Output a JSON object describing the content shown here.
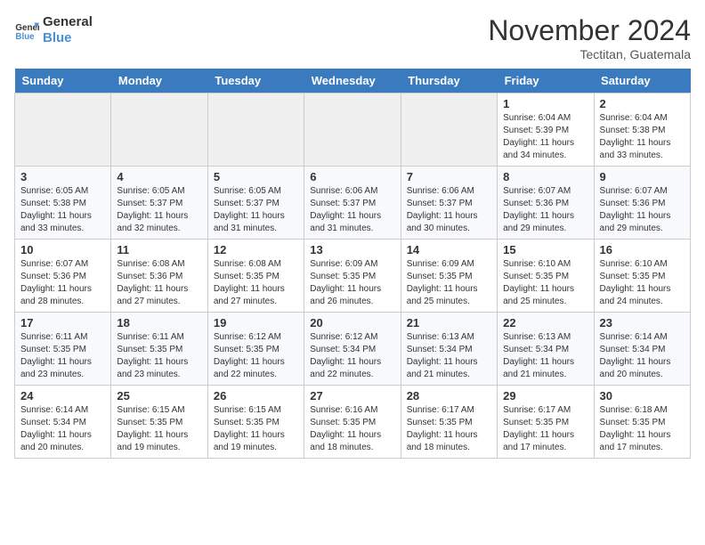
{
  "header": {
    "logo_line1": "General",
    "logo_line2": "Blue",
    "month": "November 2024",
    "location": "Tectitan, Guatemala"
  },
  "weekdays": [
    "Sunday",
    "Monday",
    "Tuesday",
    "Wednesday",
    "Thursday",
    "Friday",
    "Saturday"
  ],
  "weeks": [
    [
      {
        "day": "",
        "empty": true
      },
      {
        "day": "",
        "empty": true
      },
      {
        "day": "",
        "empty": true
      },
      {
        "day": "",
        "empty": true
      },
      {
        "day": "",
        "empty": true
      },
      {
        "day": "1",
        "sunrise": "Sunrise: 6:04 AM",
        "sunset": "Sunset: 5:39 PM",
        "daylight": "Daylight: 11 hours and 34 minutes."
      },
      {
        "day": "2",
        "sunrise": "Sunrise: 6:04 AM",
        "sunset": "Sunset: 5:38 PM",
        "daylight": "Daylight: 11 hours and 33 minutes."
      }
    ],
    [
      {
        "day": "3",
        "sunrise": "Sunrise: 6:05 AM",
        "sunset": "Sunset: 5:38 PM",
        "daylight": "Daylight: 11 hours and 33 minutes."
      },
      {
        "day": "4",
        "sunrise": "Sunrise: 6:05 AM",
        "sunset": "Sunset: 5:37 PM",
        "daylight": "Daylight: 11 hours and 32 minutes."
      },
      {
        "day": "5",
        "sunrise": "Sunrise: 6:05 AM",
        "sunset": "Sunset: 5:37 PM",
        "daylight": "Daylight: 11 hours and 31 minutes."
      },
      {
        "day": "6",
        "sunrise": "Sunrise: 6:06 AM",
        "sunset": "Sunset: 5:37 PM",
        "daylight": "Daylight: 11 hours and 31 minutes."
      },
      {
        "day": "7",
        "sunrise": "Sunrise: 6:06 AM",
        "sunset": "Sunset: 5:37 PM",
        "daylight": "Daylight: 11 hours and 30 minutes."
      },
      {
        "day": "8",
        "sunrise": "Sunrise: 6:07 AM",
        "sunset": "Sunset: 5:36 PM",
        "daylight": "Daylight: 11 hours and 29 minutes."
      },
      {
        "day": "9",
        "sunrise": "Sunrise: 6:07 AM",
        "sunset": "Sunset: 5:36 PM",
        "daylight": "Daylight: 11 hours and 29 minutes."
      }
    ],
    [
      {
        "day": "10",
        "sunrise": "Sunrise: 6:07 AM",
        "sunset": "Sunset: 5:36 PM",
        "daylight": "Daylight: 11 hours and 28 minutes."
      },
      {
        "day": "11",
        "sunrise": "Sunrise: 6:08 AM",
        "sunset": "Sunset: 5:36 PM",
        "daylight": "Daylight: 11 hours and 27 minutes."
      },
      {
        "day": "12",
        "sunrise": "Sunrise: 6:08 AM",
        "sunset": "Sunset: 5:35 PM",
        "daylight": "Daylight: 11 hours and 27 minutes."
      },
      {
        "day": "13",
        "sunrise": "Sunrise: 6:09 AM",
        "sunset": "Sunset: 5:35 PM",
        "daylight": "Daylight: 11 hours and 26 minutes."
      },
      {
        "day": "14",
        "sunrise": "Sunrise: 6:09 AM",
        "sunset": "Sunset: 5:35 PM",
        "daylight": "Daylight: 11 hours and 25 minutes."
      },
      {
        "day": "15",
        "sunrise": "Sunrise: 6:10 AM",
        "sunset": "Sunset: 5:35 PM",
        "daylight": "Daylight: 11 hours and 25 minutes."
      },
      {
        "day": "16",
        "sunrise": "Sunrise: 6:10 AM",
        "sunset": "Sunset: 5:35 PM",
        "daylight": "Daylight: 11 hours and 24 minutes."
      }
    ],
    [
      {
        "day": "17",
        "sunrise": "Sunrise: 6:11 AM",
        "sunset": "Sunset: 5:35 PM",
        "daylight": "Daylight: 11 hours and 23 minutes."
      },
      {
        "day": "18",
        "sunrise": "Sunrise: 6:11 AM",
        "sunset": "Sunset: 5:35 PM",
        "daylight": "Daylight: 11 hours and 23 minutes."
      },
      {
        "day": "19",
        "sunrise": "Sunrise: 6:12 AM",
        "sunset": "Sunset: 5:35 PM",
        "daylight": "Daylight: 11 hours and 22 minutes."
      },
      {
        "day": "20",
        "sunrise": "Sunrise: 6:12 AM",
        "sunset": "Sunset: 5:34 PM",
        "daylight": "Daylight: 11 hours and 22 minutes."
      },
      {
        "day": "21",
        "sunrise": "Sunrise: 6:13 AM",
        "sunset": "Sunset: 5:34 PM",
        "daylight": "Daylight: 11 hours and 21 minutes."
      },
      {
        "day": "22",
        "sunrise": "Sunrise: 6:13 AM",
        "sunset": "Sunset: 5:34 PM",
        "daylight": "Daylight: 11 hours and 21 minutes."
      },
      {
        "day": "23",
        "sunrise": "Sunrise: 6:14 AM",
        "sunset": "Sunset: 5:34 PM",
        "daylight": "Daylight: 11 hours and 20 minutes."
      }
    ],
    [
      {
        "day": "24",
        "sunrise": "Sunrise: 6:14 AM",
        "sunset": "Sunset: 5:34 PM",
        "daylight": "Daylight: 11 hours and 20 minutes."
      },
      {
        "day": "25",
        "sunrise": "Sunrise: 6:15 AM",
        "sunset": "Sunset: 5:35 PM",
        "daylight": "Daylight: 11 hours and 19 minutes."
      },
      {
        "day": "26",
        "sunrise": "Sunrise: 6:15 AM",
        "sunset": "Sunset: 5:35 PM",
        "daylight": "Daylight: 11 hours and 19 minutes."
      },
      {
        "day": "27",
        "sunrise": "Sunrise: 6:16 AM",
        "sunset": "Sunset: 5:35 PM",
        "daylight": "Daylight: 11 hours and 18 minutes."
      },
      {
        "day": "28",
        "sunrise": "Sunrise: 6:17 AM",
        "sunset": "Sunset: 5:35 PM",
        "daylight": "Daylight: 11 hours and 18 minutes."
      },
      {
        "day": "29",
        "sunrise": "Sunrise: 6:17 AM",
        "sunset": "Sunset: 5:35 PM",
        "daylight": "Daylight: 11 hours and 17 minutes."
      },
      {
        "day": "30",
        "sunrise": "Sunrise: 6:18 AM",
        "sunset": "Sunset: 5:35 PM",
        "daylight": "Daylight: 11 hours and 17 minutes."
      }
    ]
  ]
}
